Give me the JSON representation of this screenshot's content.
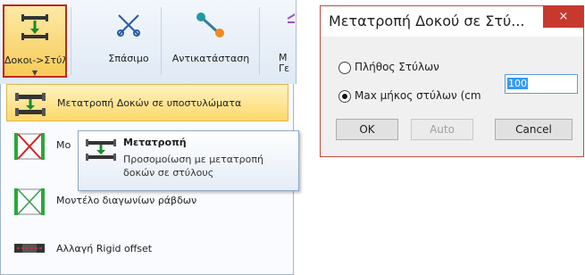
{
  "ribbon": {
    "buttons": [
      {
        "label": "Δοκοι->Στύλοι",
        "icon": "beam-to-column-icon",
        "active": true
      },
      {
        "label": "Σπάσιμο",
        "icon": "split-icon"
      },
      {
        "label": "Αντικατάσταση",
        "icon": "replace-icon"
      },
      {
        "label": "Μ Γε",
        "icon": "model-icon"
      }
    ]
  },
  "menu": {
    "items": [
      {
        "label": "Μετατροπή Δοκών σε υποστυλώματα",
        "icon": "beam-column-convert-icon"
      },
      {
        "label": "Μο",
        "icon": "cross-brace-red-icon"
      },
      {
        "label": "Μοντέλο διαγωνίων ράβδων",
        "icon": "cross-brace-green-icon"
      },
      {
        "label": "Αλλαγή Rigid offset",
        "icon": "rigid-offset-icon"
      }
    ]
  },
  "tooltip": {
    "title": "Μετατροπή",
    "description": "Προσομοίωση με μετατροπή δοκών σε στύλους"
  },
  "dialog": {
    "title": "Μετατροπή Δοκού σε Στύ...",
    "close_label": "×",
    "options": [
      {
        "label": "Πλήθος Στύλων",
        "selected": false
      },
      {
        "label": "Max μήκος στύλων (cm",
        "selected": true
      }
    ],
    "value": "100",
    "buttons": {
      "ok": "OK",
      "auto": "Auto",
      "cancel": "Cancel"
    }
  },
  "colors": {
    "accent_red": "#c7392e",
    "highlight": "#ffd86b",
    "ribbon": "#dfe9f5"
  }
}
